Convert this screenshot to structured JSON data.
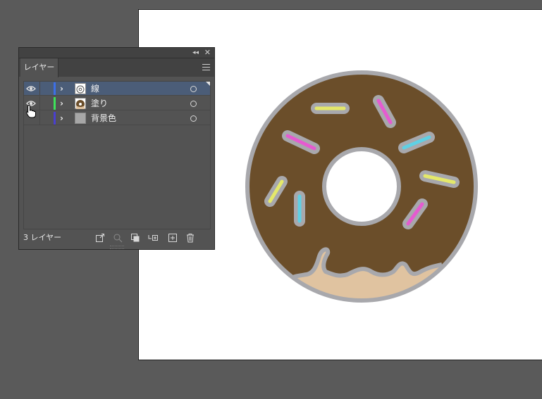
{
  "panel": {
    "tab_label": "レイヤー",
    "layers": [
      {
        "name": "線",
        "color": "#3d6fe6",
        "selected": true,
        "thumbnail": "line-art-thumbnail"
      },
      {
        "name": "塗り",
        "color": "#3ee25a",
        "selected": false,
        "thumbnail": "donut-thumbnail"
      },
      {
        "name": "背景色",
        "color": "#4a3fcf",
        "selected": false,
        "thumbnail": "gray-swatch-thumbnail"
      }
    ],
    "layer_count": "3 レイヤー",
    "footer_buttons": [
      "export-icon",
      "locate-object-icon",
      "clipping-mask-icon",
      "new-sublayer-icon",
      "new-layer-icon",
      "delete-icon"
    ]
  },
  "artwork": {
    "icing_color": "#6b4e2a",
    "dough_color": "#e0c3a0",
    "outline_color": "#a8a8ac",
    "sprinkle_colors": [
      "#e4e86a",
      "#e55bd0",
      "#5fd0e4"
    ]
  }
}
